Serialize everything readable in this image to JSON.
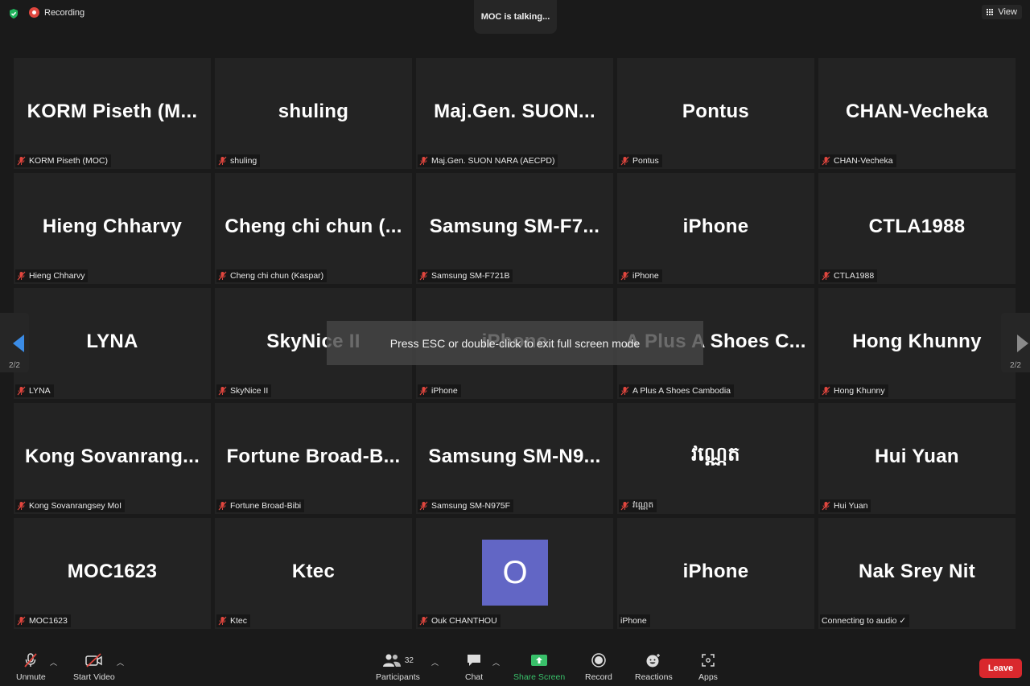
{
  "top": {
    "recording_label": "Recording",
    "talking": "MOC is talking...",
    "view_label": "View"
  },
  "tiles": [
    {
      "big": "KORM Piseth (M...",
      "label": "KORM Piseth (MOC)",
      "muted": true
    },
    {
      "big": "shuling",
      "label": "shuling",
      "muted": true
    },
    {
      "big": "Maj.Gen. SUON...",
      "label": "Maj.Gen. SUON NARA (AECPD)",
      "muted": true
    },
    {
      "big": "Pontus",
      "label": "Pontus",
      "muted": true
    },
    {
      "big": "CHAN-Vecheka",
      "label": "CHAN-Vecheka",
      "muted": true
    },
    {
      "big": "Hieng Chharvy",
      "label": "Hieng Chharvy",
      "muted": true
    },
    {
      "big": "Cheng chi chun (...",
      "label": "Cheng chi chun (Kaspar)",
      "muted": true
    },
    {
      "big": "Samsung SM-F7...",
      "label": "Samsung SM-F721B",
      "muted": true
    },
    {
      "big": "iPhone",
      "label": "iPhone",
      "muted": true
    },
    {
      "big": "CTLA1988",
      "label": "CTLA1988",
      "muted": true
    },
    {
      "big": "LYNA",
      "label": "LYNA",
      "muted": true
    },
    {
      "big": "SkyNice II",
      "label": "SkyNice II",
      "muted": true
    },
    {
      "big": "iPhone",
      "label": "iPhone",
      "muted": true
    },
    {
      "big": "A Plus A Shoes C...",
      "label": "A Plus A Shoes Cambodia",
      "muted": true
    },
    {
      "big": "Hong Khunny",
      "label": "Hong Khunny",
      "muted": true
    },
    {
      "big": "Kong Sovanrang...",
      "label": "Kong Sovanrangsey MoI",
      "muted": true
    },
    {
      "big": "Fortune Broad-B...",
      "label": "Fortune Broad-Bibi",
      "muted": true
    },
    {
      "big": "Samsung SM-N9...",
      "label": "Samsung SM-N975F",
      "muted": true
    },
    {
      "big": "វណ្ណេត",
      "label": "វណ្ណេត",
      "muted": true
    },
    {
      "big": "Hui Yuan",
      "label": "Hui Yuan",
      "muted": true
    },
    {
      "big": "MOC1623",
      "label": "MOC1623",
      "muted": true
    },
    {
      "big": "Ktec",
      "label": "Ktec",
      "muted": true
    },
    {
      "big": "",
      "avatar": "O",
      "label": "Ouk CHANTHOU",
      "muted": true
    },
    {
      "big": "iPhone",
      "label": "iPhone",
      "muted": false
    },
    {
      "big": "Nak Srey Nit",
      "label": "Connecting to audio ✓",
      "muted": false
    }
  ],
  "nav": {
    "left_page": "2/2",
    "right_page": "2/2"
  },
  "overlay": "Press ESC or double-click to exit full screen mode",
  "toolbar": {
    "unmute": "Unmute",
    "start_video": "Start Video",
    "participants": "Participants",
    "participants_count": "32",
    "chat": "Chat",
    "share_screen": "Share Screen",
    "record": "Record",
    "reactions": "Reactions",
    "apps": "Apps",
    "leave": "Leave"
  },
  "colors": {
    "accent_blue": "#3b8ce6",
    "share_green": "#39c06a",
    "leave_red": "#d9282d",
    "avatar": "#6266c5",
    "mute_red": "#e0463e"
  }
}
